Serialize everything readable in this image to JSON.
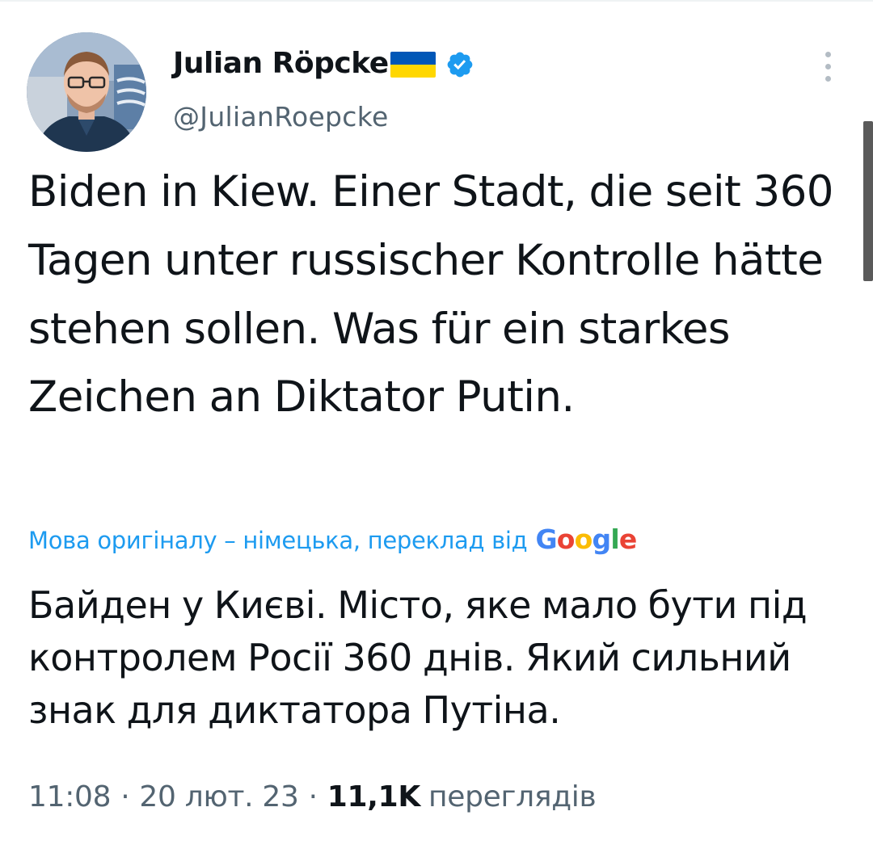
{
  "tweet": {
    "author": {
      "name": "Julian Röpcke",
      "handle": "@JulianRoepcke",
      "verified": true,
      "flag_icon": "ukraine-flag-icon"
    },
    "text": "Biden in Kiew. Einer Stadt, die seit 360 Tagen unter russischer Kontrolle hätte stehen sollen. Was für ein starkes Zeichen an Diktator Putin.",
    "translation": {
      "note": "Мова оригіналу – німецька, переклад від",
      "provider": "Google",
      "text": "Байден у Києві. Місто, яке мало бути під контролем Росії 360 днів. Який сильний знак для диктатора Путіна."
    },
    "meta": {
      "time": "11:08",
      "separator": "·",
      "date": "20 лют. 23",
      "views_count": "11,1K",
      "views_label": "переглядів"
    }
  },
  "colors": {
    "accent": "#1d9bf0",
    "text_primary": "#0f1419",
    "text_secondary": "#536471",
    "flag_blue": "#0057b7",
    "flag_yellow": "#ffd700"
  }
}
